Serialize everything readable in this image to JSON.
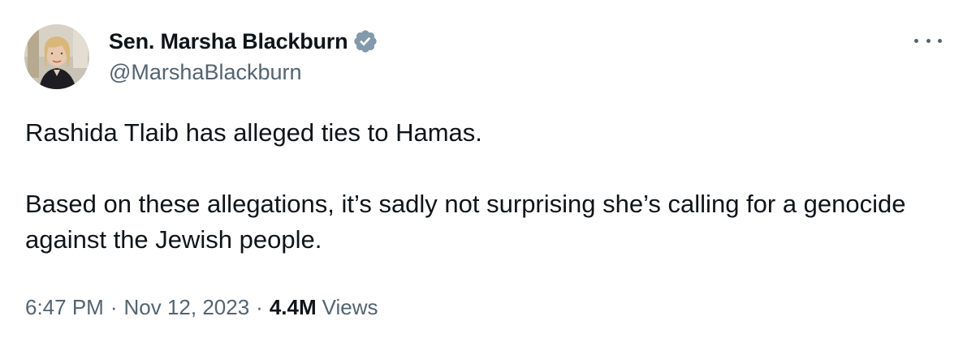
{
  "author": {
    "display_name": "Sen. Marsha Blackburn",
    "handle": "@MarshaBlackburn",
    "verified": true,
    "verified_color": "#829aab",
    "avatar_icon": "profile-photo"
  },
  "tweet": {
    "paragraphs": [
      "Rashida Tlaib has alleged ties to Hamas.",
      "Based on these allegations, it’s sadly not surprising she’s calling for a genocide against the Jewish people."
    ]
  },
  "meta": {
    "time": "6:47 PM",
    "separator": "·",
    "date": "Nov 12, 2023",
    "views_count": "4.4M",
    "views_label": "Views"
  },
  "menu": {
    "icon": "more-horizontal-icon"
  },
  "colors": {
    "text_primary": "#0f1419",
    "text_secondary": "#536471",
    "background": "#ffffff"
  }
}
